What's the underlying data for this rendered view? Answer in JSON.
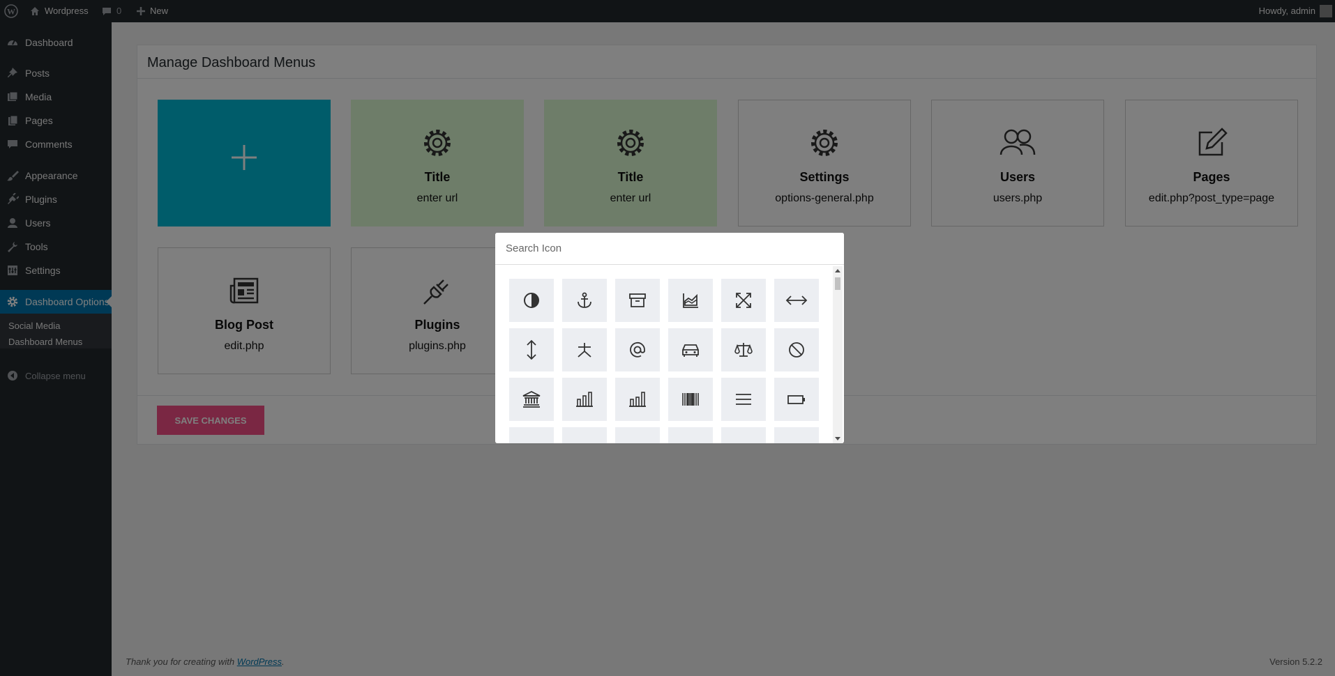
{
  "admin_bar": {
    "site_name": "Wordpress",
    "comments_count": "0",
    "new_label": "New",
    "greeting": "Howdy, admin"
  },
  "sidebar": {
    "items": [
      {
        "label": "Dashboard",
        "icon": "dashboard-icon"
      },
      {
        "label": "Posts",
        "icon": "pin-icon"
      },
      {
        "label": "Media",
        "icon": "media-icon"
      },
      {
        "label": "Pages",
        "icon": "pages-icon"
      },
      {
        "label": "Comments",
        "icon": "comment-icon"
      },
      {
        "label": "Appearance",
        "icon": "brush-icon"
      },
      {
        "label": "Plugins",
        "icon": "plugin-icon"
      },
      {
        "label": "Users",
        "icon": "user-icon"
      },
      {
        "label": "Tools",
        "icon": "wrench-icon"
      },
      {
        "label": "Settings",
        "icon": "settings-icon"
      },
      {
        "label": "Dashboard Options",
        "icon": "gear-icon"
      }
    ],
    "submenu": [
      "Social Media",
      "Dashboard Menus"
    ],
    "collapse_label": "Collapse menu"
  },
  "panel": {
    "title": "Manage Dashboard Menus",
    "cards": [
      {
        "title": "",
        "url": "",
        "icon": "plus-icon"
      },
      {
        "title": "Title",
        "url": "enter url",
        "icon": "gear-icon"
      },
      {
        "title": "Title",
        "url": "enter url",
        "icon": "gear-icon"
      },
      {
        "title": "Settings",
        "url": "options-general.php",
        "icon": "gear-icon"
      },
      {
        "title": "Users",
        "url": "users.php",
        "icon": "users-icon"
      },
      {
        "title": "Pages",
        "url": "edit.php?post_type=page",
        "icon": "edit-icon"
      },
      {
        "title": "Blog Post",
        "url": "edit.php",
        "icon": "newspaper-icon"
      },
      {
        "title": "Plugins",
        "url": "plugins.php",
        "icon": "plug-icon"
      }
    ],
    "save_label": "SAVE CHANGES"
  },
  "footer": {
    "thanks_prefix": "Thank you for creating with ",
    "thanks_link": "WordPress",
    "thanks_suffix": ".",
    "version": "Version 5.2.2"
  },
  "icon_picker": {
    "search_placeholder": "Search Icon",
    "icons": [
      "adjust-icon",
      "anchor-icon",
      "archive-icon",
      "area-chart-icon",
      "arrows-expand-icon",
      "arrows-horizontal-icon",
      "arrows-vertical-icon",
      "asterisk-icon",
      "at-icon",
      "car-icon",
      "balance-scale-icon",
      "ban-icon",
      "bank-icon",
      "bar-chart-icon",
      "bar-chart-alt-icon",
      "barcode-icon",
      "bars-icon",
      "battery-icon"
    ]
  },
  "colors": {
    "accent": "#00b8d4",
    "green_card": "#dcfad3",
    "save_button": "#f44f86",
    "wp_blue": "#0073aa"
  }
}
